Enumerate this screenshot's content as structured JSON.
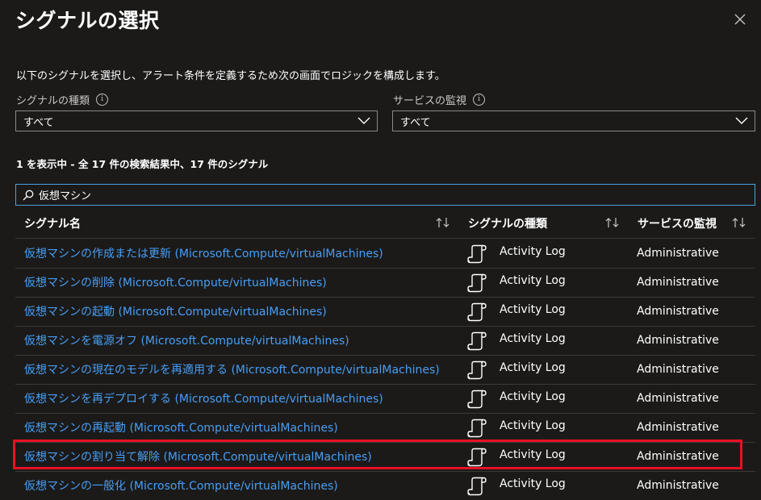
{
  "panel": {
    "title": "シグナルの選択",
    "description": "以下のシグナルを選択し、アラート条件を定義するため次の画面でロジックを構成します。"
  },
  "filters": {
    "signal_type_label": "シグナルの種類",
    "signal_type_value": "すべて",
    "service_label": "サービスの監視",
    "service_value": "すべて"
  },
  "results_summary": "1 を表示中 - 全 17 件の検索結果中、17 件のシグナル",
  "search": {
    "value": "仮想マシン",
    "icon": "search-icon"
  },
  "table": {
    "columns": [
      "シグナル名",
      "シグナルの種類",
      "サービスの監視"
    ],
    "rows": [
      {
        "name": "仮想マシンの作成または更新 (Microsoft.Compute/virtualMachines)",
        "type": "Activity Log",
        "service": "Administrative"
      },
      {
        "name": "仮想マシンの削除 (Microsoft.Compute/virtualMachines)",
        "type": "Activity Log",
        "service": "Administrative"
      },
      {
        "name": "仮想マシンの起動 (Microsoft.Compute/virtualMachines)",
        "type": "Activity Log",
        "service": "Administrative"
      },
      {
        "name": "仮想マシンを電源オフ (Microsoft.Compute/virtualMachines)",
        "type": "Activity Log",
        "service": "Administrative"
      },
      {
        "name": "仮想マシンの現在のモデルを再適用する (Microsoft.Compute/virtualMachines)",
        "type": "Activity Log",
        "service": "Administrative"
      },
      {
        "name": "仮想マシンを再デプロイする (Microsoft.Compute/virtualMachines)",
        "type": "Activity Log",
        "service": "Administrative"
      },
      {
        "name": "仮想マシンの再起動 (Microsoft.Compute/virtualMachines)",
        "type": "Activity Log",
        "service": "Administrative"
      },
      {
        "name": "仮想マシンの割り当て解除 (Microsoft.Compute/virtualMachines)",
        "type": "Activity Log",
        "service": "Administrative"
      },
      {
        "name": "仮想マシンの一般化 (Microsoft.Compute/virtualMachines)",
        "type": "Activity Log",
        "service": "Administrative"
      }
    ]
  },
  "colors": {
    "background": "#1b1a19",
    "link": "#479ef5",
    "highlight": "#e81123",
    "focus_border": "#4aa3df"
  }
}
